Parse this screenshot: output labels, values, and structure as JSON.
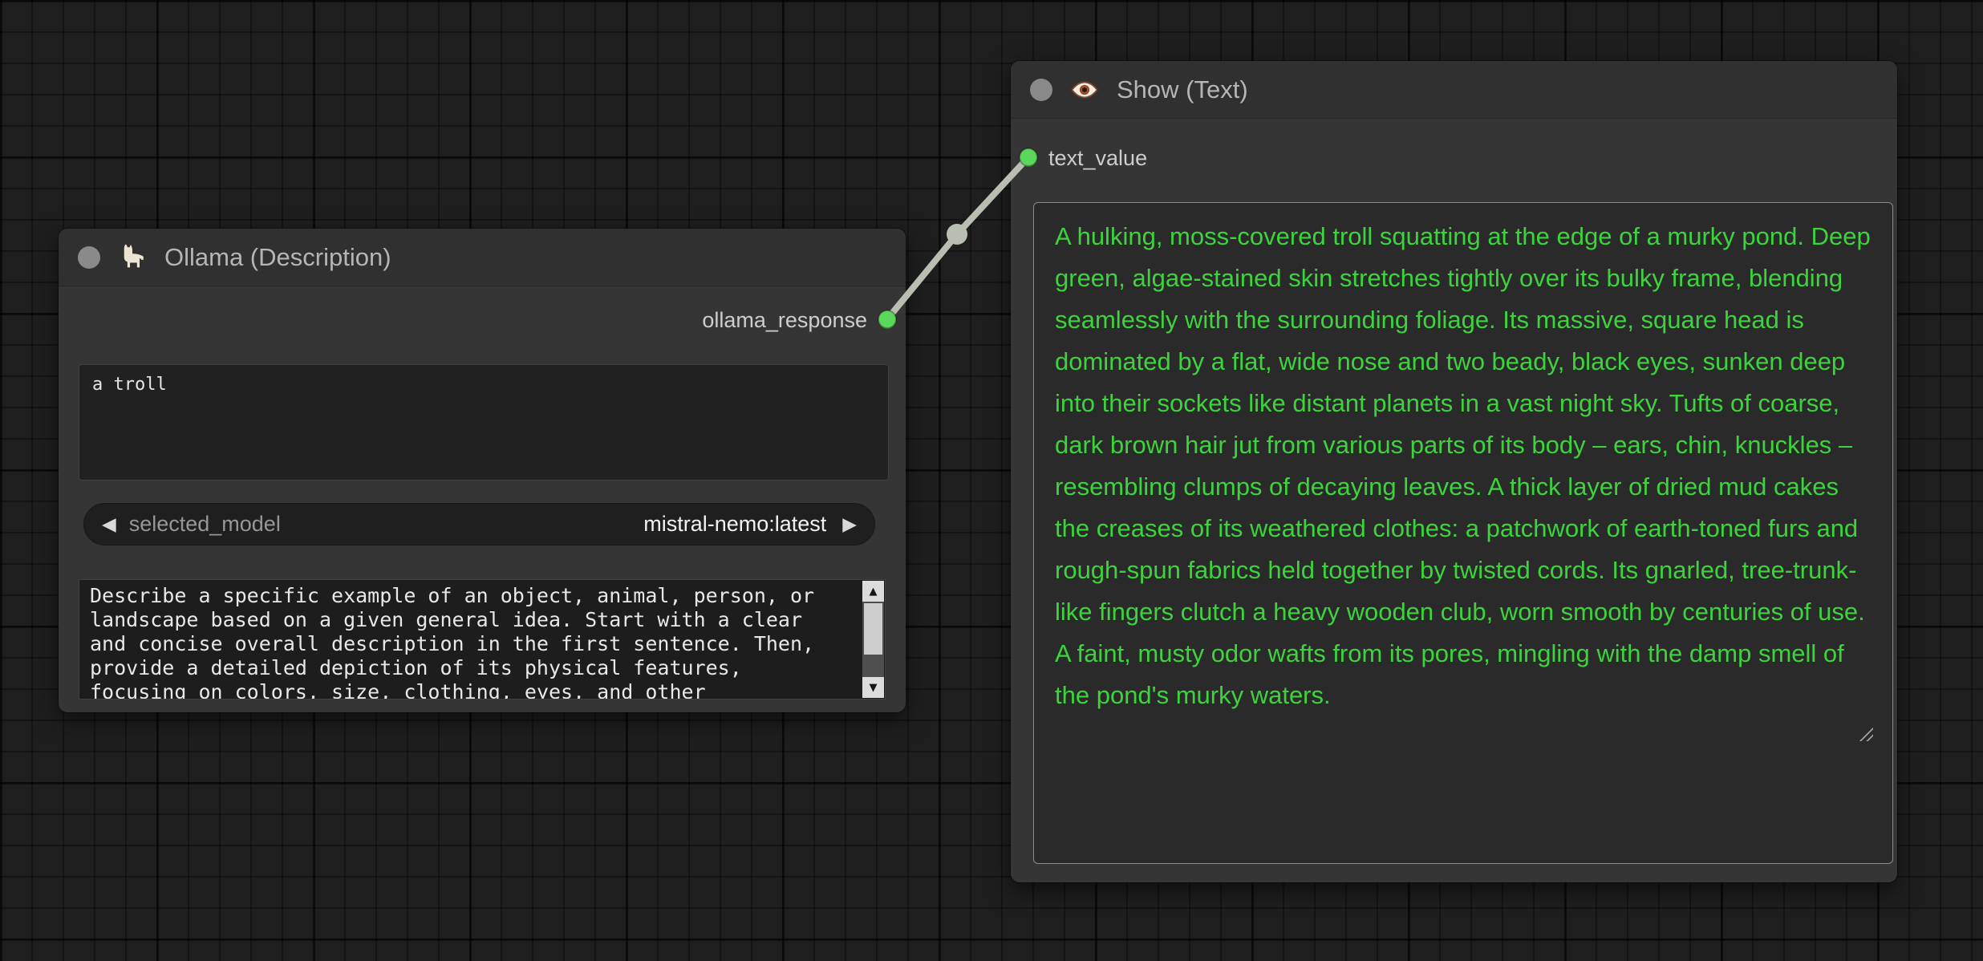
{
  "canvas": {
    "background": "#1e1e1e"
  },
  "ollama_node": {
    "title": "Ollama (Description)",
    "output_slot": "ollama_response",
    "text_input": "a troll",
    "model_widget": {
      "label": "selected_model",
      "value": "mistral-nemo:latest"
    },
    "prompt_text": "Describe a specific example of an object, animal, person, or landscape based on a given general idea. Start with a clear and concise overall description in the first sentence. Then, provide a detailed depiction of its physical features, focusing on colors, size, clothing, eyes, and other"
  },
  "show_node": {
    "title": "Show (Text)",
    "input_slot": "text_value",
    "text_value": "A hulking, moss-covered troll squatting at the edge of a murky pond. Deep green, algae-stained skin stretches tightly over its bulky frame, blending seamlessly with the surrounding foliage. Its massive, square head is dominated by a flat, wide nose and two beady, black eyes, sunken deep into their sockets like distant planets in a vast night sky. Tufts of coarse, dark brown hair jut from various parts of its body – ears, chin, knuckles – resembling clumps of decaying leaves. A thick layer of dried mud cakes the creases of its weathered clothes: a patchwork of earth-toned furs and rough-spun fabrics held together by twisted cords. Its gnarled, tree-trunk-like fingers clutch a heavy wooden club, worn smooth by centuries of use. A faint, musty odor wafts from its pores, mingling with the damp smell of the pond's murky waters."
  },
  "icons": {
    "prev": "◀",
    "next": "▶",
    "scroll_up": "▲",
    "scroll_down": "▼"
  },
  "colors": {
    "output_text_green": "#3dd33d",
    "slot_green": "#5bd75b",
    "link": "#b8beb2"
  }
}
